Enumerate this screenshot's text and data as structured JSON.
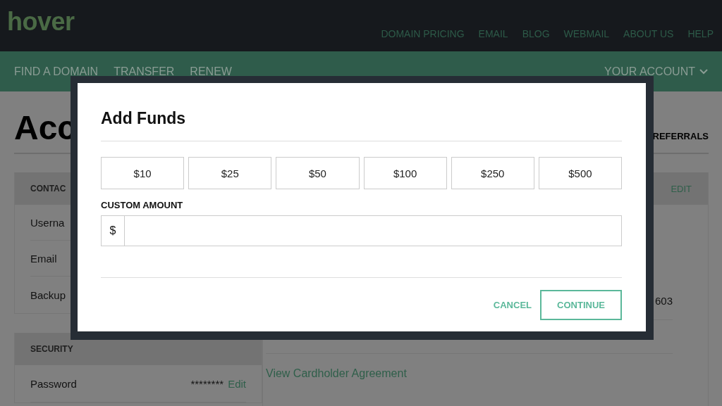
{
  "header": {
    "logo": "hover",
    "links": [
      "DOMAIN PRICING",
      "EMAIL",
      "BLOG",
      "WEBMAIL",
      "ABOUT US",
      "HELP"
    ]
  },
  "nav": {
    "items": [
      "FIND A DOMAIN",
      "TRANSFER",
      "RENEW"
    ],
    "account": "YOUR ACCOUNT"
  },
  "page": {
    "title": "Acc",
    "tab": "REFERRALS"
  },
  "contact_panel": {
    "heading": "CONTAC",
    "rows": [
      "Userna",
      "Email",
      "Backup"
    ]
  },
  "security_panel": {
    "heading": "SECURITY",
    "rows": [
      {
        "label": "Password",
        "value": "********",
        "action": "Edit"
      }
    ]
  },
  "right_panel": {
    "action": "EDIT",
    "value": "603",
    "link": "View Cardholder Agreement"
  },
  "modal": {
    "title": "Add Funds",
    "amounts": [
      "$10",
      "$25",
      "$50",
      "$100",
      "$250",
      "$500"
    ],
    "custom_label": "CUSTOM AMOUNT",
    "prefix": "$",
    "cancel": "CANCEL",
    "continue": "CONTINUE"
  }
}
